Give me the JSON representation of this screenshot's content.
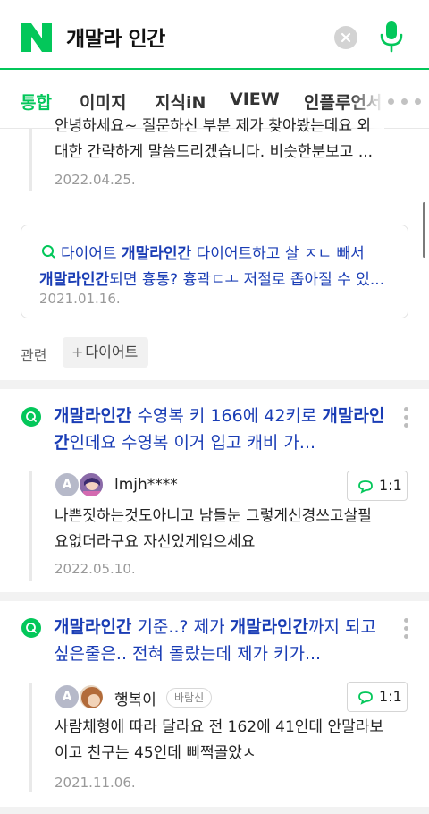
{
  "search": {
    "query": "개말라 인간"
  },
  "tabs": [
    "통합",
    "이미지",
    "지식iN",
    "VIEW",
    "인플루언서"
  ],
  "prev_result": {
    "line1": "안녕하세요~ 질문하신 부분 제가 찾아봤는데요 외",
    "line2": "대한 간략하게 말씀드리겠습니다. 비슷한분보고 ...",
    "date": "2022.04.25."
  },
  "related_answer": {
    "pre": "다이어트 ",
    "kw1": "개말라인간",
    "mid": " 다이어트하고 살 ㅈㄴ 빼서",
    "kw2": "개말라인간",
    "post": "되면 흉통? 흉곽ㄷㅗ 저절로 좁아질 수 있...",
    "date": "2021.01.16."
  },
  "related_tags": {
    "label": "관련",
    "chip": "다이어트"
  },
  "qa_items": [
    {
      "title_kw1": "개말라인간",
      "title_mid": " 수영복 키 166에 42키로 ",
      "title_kw2": "개말라인간",
      "title_post": "인데요 수영복 이거 입고 캐비 가...",
      "author": "lmjh****",
      "count": "1:1",
      "answer_line1": "나쁜짓하는것도아니고 남들눈 그렇게신경쓰고살필",
      "answer_line2": "요없더라구요 자신있게입으세요",
      "date": "2022.05.10."
    },
    {
      "title_kw1": "개말라인간",
      "title_mid": " 기준..? 제가 ",
      "title_kw2": "개말라인간",
      "title_post": "까지 되고 싶은줄은.. 전혀 몰랐는데 제가 키가...",
      "author": "행복이",
      "badge": "바람신",
      "count": "1:1",
      "answer_line1": "사람체형에 따라 달라요 전 162에 41인데 안말라보",
      "answer_line2": "이고 친구는 45인데 삐쩍골았ㅅ",
      "date": "2021.11.06."
    }
  ],
  "colors": {
    "brand": "#03c75a",
    "link": "#1a3db5"
  }
}
